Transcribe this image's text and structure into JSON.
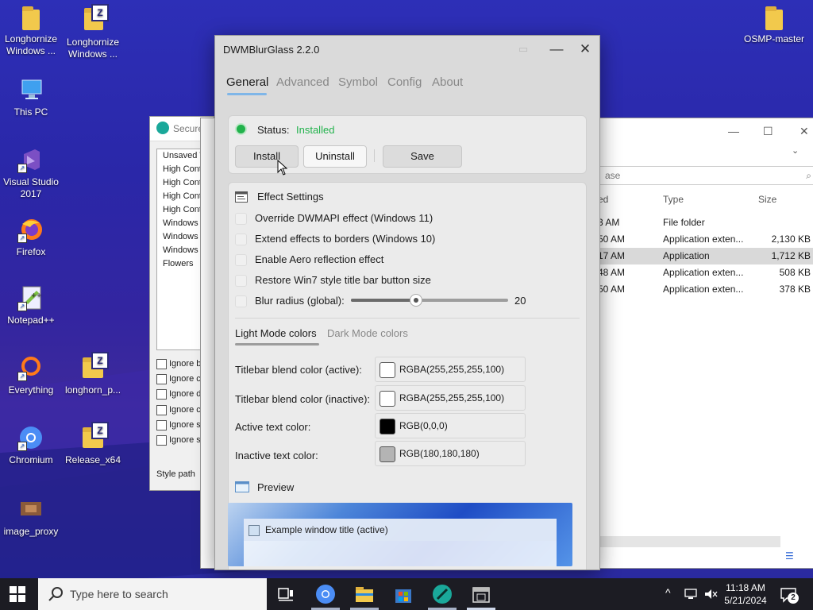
{
  "desktop": {
    "icons": [
      {
        "label": "Longhornize Windows ...",
        "type": "folder"
      },
      {
        "label": "Longhornize Windows ...",
        "type": "zip"
      },
      {
        "label": "This PC",
        "type": "pc"
      },
      {
        "label": "Visual Studio 2017",
        "type": "vs"
      },
      {
        "label": "Firefox",
        "type": "firefox"
      },
      {
        "label": "Notepad++",
        "type": "notepad"
      },
      {
        "label": "Everything",
        "type": "everything"
      },
      {
        "label": "longhorn_p...",
        "type": "zip"
      },
      {
        "label": "Chromium",
        "type": "chromium"
      },
      {
        "label": "Release_x64",
        "type": "zip"
      },
      {
        "label": "image_proxy",
        "type": "image"
      },
      {
        "label": "OSMP-master",
        "type": "folder"
      }
    ]
  },
  "secureux": {
    "title": "Secure",
    "list": [
      "Unsaved T",
      "High Cont",
      "High Cont",
      "High Cont",
      "High Cont",
      "Windows",
      "Windows",
      "Windows",
      "Flowers"
    ],
    "checks": [
      "Ignore b",
      "Ignore c",
      "Ignore d",
      "Ignore c",
      "Ignore s",
      "Ignore s"
    ],
    "style_path": "Style path"
  },
  "explorer": {
    "search_placeholder": "ase",
    "headers": {
      "date": "ed",
      "type": "Type",
      "size": "Size"
    },
    "rows": [
      {
        "time": "3 AM",
        "type": "File folder",
        "size": ""
      },
      {
        "time": "50 AM",
        "type": "Application exten...",
        "size": "2,130 KB"
      },
      {
        "time": "17 AM",
        "type": "Application",
        "size": "1,712 KB",
        "selected": true
      },
      {
        "time": "48 AM",
        "type": "Application exten...",
        "size": "508 KB"
      },
      {
        "time": "50 AM",
        "type": "Application exten...",
        "size": "378 KB"
      }
    ]
  },
  "window": {
    "title": "DWMBlurGlass 2.2.0",
    "tabs": [
      "General",
      "Advanced",
      "Symbol",
      "Config",
      "About"
    ],
    "active_tab": "General",
    "status_label": "Status:",
    "status_value": "Installed",
    "status_color": "#22b24c",
    "buttons": {
      "install": "Install",
      "uninstall": "Uninstall",
      "save": "Save"
    },
    "effect_settings_title": "Effect Settings",
    "options": [
      "Override DWMAPI effect (Windows 11)",
      "Extend effects to borders (Windows 10)",
      "Enable Aero reflection effect",
      "Restore Win7 style title bar button size"
    ],
    "blur_label": "Blur radius (global):",
    "blur_value": "20",
    "blur_fraction": 0.41,
    "subtabs": [
      "Light Mode colors",
      "Dark Mode colors"
    ],
    "colors": [
      {
        "label": "Titlebar blend color (active):",
        "value": "RGBA(255,255,255,100)",
        "swatch": "#ffffff"
      },
      {
        "label": "Titlebar blend color (inactive):",
        "value": "RGBA(255,255,255,100)",
        "swatch": "#ffffff"
      },
      {
        "label": "Active text color:",
        "value": "RGB(0,0,0)",
        "swatch": "#000000"
      },
      {
        "label": "Inactive text color:",
        "value": "RGB(180,180,180)",
        "swatch": "#b4b4b4"
      }
    ],
    "preview_label": "Preview",
    "preview_window_title": "Example window title (active)"
  },
  "taskbar": {
    "search_placeholder": "Type here to search",
    "time": "11:18 AM",
    "date": "5/21/2024",
    "notification_count": "2"
  }
}
